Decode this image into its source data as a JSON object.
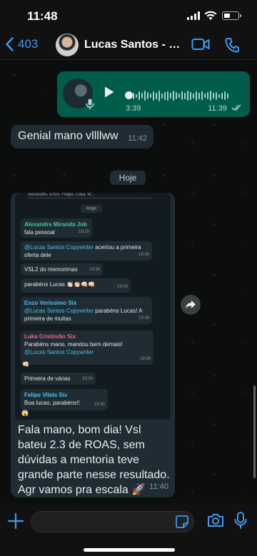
{
  "status_bar": {
    "time": "11:48"
  },
  "header": {
    "back_count": "403",
    "contact_name": "Lucas Santos - Co...",
    "icons": [
      "back-chevron-icon",
      "video-call-icon",
      "phone-icon"
    ]
  },
  "voice_message": {
    "duration": "3:39",
    "time": "11:39"
  },
  "message_1": {
    "text": "Genial mano vllllww",
    "time": "11:42"
  },
  "day_divider": "Hoje",
  "forwarded_screenshot": {
    "participants": "Alexandre, Enzo, Felipe, Luka, M...",
    "day": "Hoje",
    "messages": [
      {
        "sender": "Alexandre Miranda Job",
        "sender_color": "#4fc3a1",
        "text": "fala pessoal",
        "time": "19:25"
      },
      {
        "sender": "",
        "mention": "@Lucas Santos Copywriter",
        "text": " acertou a primeira oferta dele",
        "time": "19:26"
      },
      {
        "sender": "",
        "text": "VSL2 do memorimax",
        "time": "19:26"
      },
      {
        "sender": "",
        "text": "parabéns Lucas 👏🏻👏🏻👊🏻👊🏻",
        "time": "19:26"
      },
      {
        "sender": "Enzo Veríssimo Six",
        "sender_color": "#53bdeb",
        "mention": "@Lucas Santos Copywriter",
        "text": " parabéns Lucas! A primeira de muitas",
        "time": "19:26"
      },
      {
        "sender": "Luka Cristóvão Six",
        "sender_color": "#f06292",
        "text": "Parabéns mano, mandou bem demais!",
        "mention": "@Lucas Santos Copywriter",
        "time": "19:29"
      },
      {
        "sender": "",
        "text": "👊🏻",
        "time": ""
      },
      {
        "sender": "",
        "text": "Primeira de várias",
        "time": "19:30"
      },
      {
        "sender": "Felipe Vilela Six",
        "sender_color": "#53bdeb",
        "text": "Boa lucao, parabéns!!",
        "time": "19:30"
      },
      {
        "sender": "",
        "text": "😱",
        "time": ""
      }
    ]
  },
  "message_2": {
    "text": "Fala mano, bom dia! Vsl bateu 2.3 de ROAS, sem dúvidas a mentoria teve grande parte nesse resultado. Agr vamos pra escala 🚀",
    "time": "11:40"
  },
  "colors": {
    "accent": "#3b9cf0",
    "outgoing_bubble": "#005c4b",
    "incoming_bubble": "#202c33"
  }
}
